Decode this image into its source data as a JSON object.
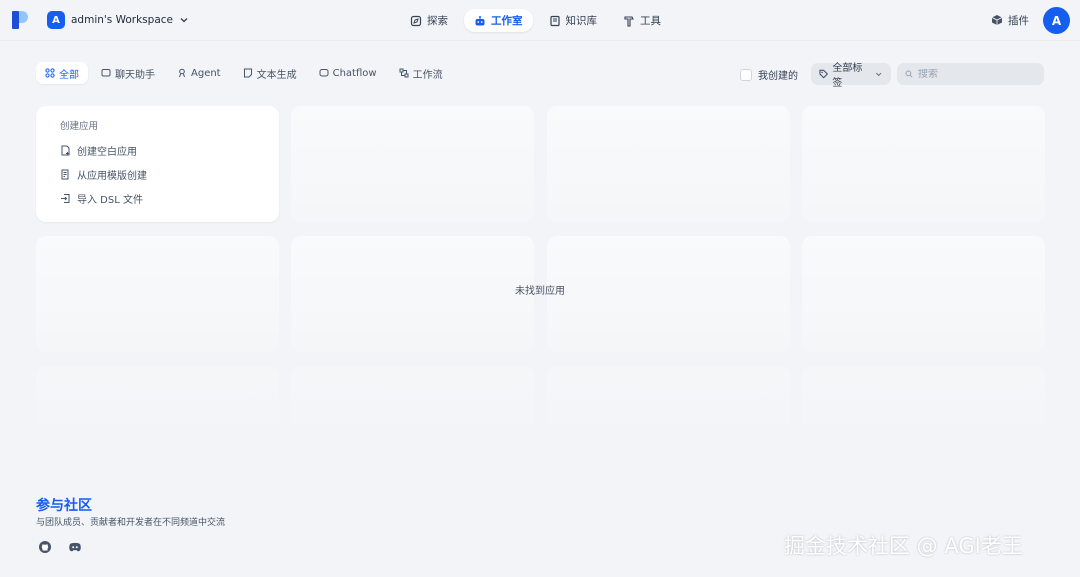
{
  "header": {
    "workspace_initial": "A",
    "workspace_name": "admin's Workspace",
    "nav": [
      {
        "label": "探索",
        "icon": "compass-icon"
      },
      {
        "label": "工作室",
        "icon": "robot-icon",
        "active": true
      },
      {
        "label": "知识库",
        "icon": "book-icon"
      },
      {
        "label": "工具",
        "icon": "hammer-icon"
      }
    ],
    "plugin_label": "插件",
    "user_initial": "A"
  },
  "filters": {
    "tabs": [
      {
        "label": "全部",
        "icon": "grid-icon",
        "active": true
      },
      {
        "label": "聊天助手",
        "icon": "chat-icon"
      },
      {
        "label": "Agent",
        "icon": "agent-icon"
      },
      {
        "label": "文本生成",
        "icon": "doc-icon"
      },
      {
        "label": "Chatflow",
        "icon": "chatflow-icon"
      },
      {
        "label": "工作流",
        "icon": "workflow-icon"
      }
    ],
    "mine_label": "我创建的",
    "tag_label": "全部标签",
    "search_placeholder": "搜索"
  },
  "create": {
    "title": "创建应用",
    "items": [
      {
        "label": "创建空白应用",
        "icon": "blank-file-icon"
      },
      {
        "label": "从应用模版创建",
        "icon": "template-icon"
      },
      {
        "label": "导入 DSL 文件",
        "icon": "import-icon"
      }
    ]
  },
  "empty_state": "未找到应用",
  "footer": {
    "community_title": "参与社区",
    "community_desc": "与团队成员、贡献者和开发者在不同频道中交流",
    "social": [
      "github-icon",
      "discord-icon"
    ]
  },
  "watermark": "掘金技术社区 @ AGI老王",
  "colors": {
    "accent": "#155eef",
    "background": "#f2f4f7"
  }
}
